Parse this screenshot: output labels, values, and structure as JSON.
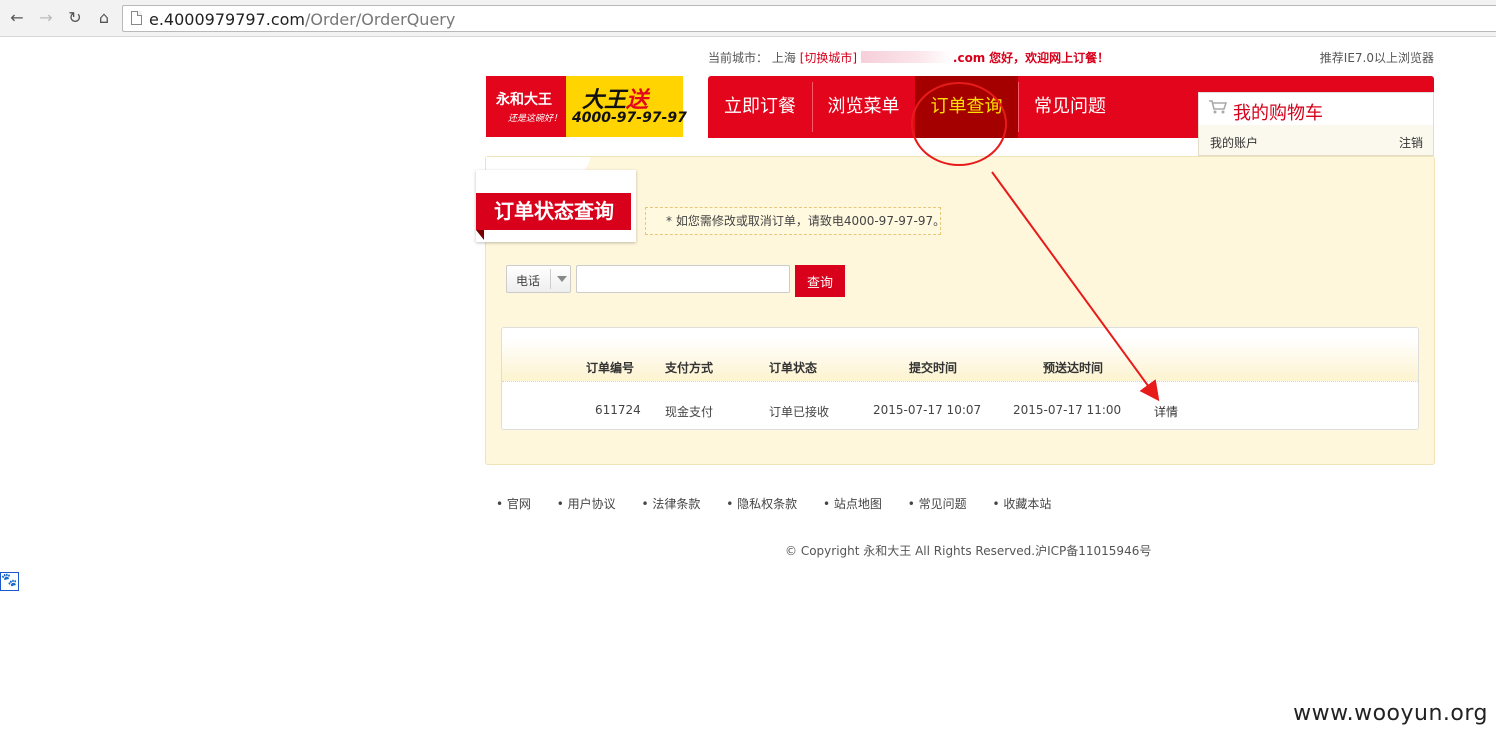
{
  "browser": {
    "back_icon": "←",
    "forward_icon": "→",
    "reload_icon": "↻",
    "home_icon": "⌂",
    "url_host": "e.4000979797.com",
    "url_path": "/Order/OrderQuery"
  },
  "topbar": {
    "city_label": "当前城市：",
    "city": "上海",
    "switch_city": "[切换城市]",
    "user_suffix": ".com",
    "welcome": "您好，欢迎网上订餐！",
    "browser_tip": "推荐IE7.0以上浏览器"
  },
  "logo": {
    "brand": "永和大王",
    "slogan": "还是这碗好！",
    "delivery": "大王",
    "delivery_red": "送",
    "phone": "4000-97-97-97"
  },
  "nav": {
    "items": [
      "立即订餐",
      "浏览菜单",
      "订单查询",
      "常见问题"
    ],
    "active_index": 2
  },
  "cart": {
    "icon": "cart-icon",
    "label": "我的购物车",
    "my_account": "我的账户",
    "logout": "注销"
  },
  "section": {
    "title": "订单状态查询",
    "notice": "* 如您需修改或取消订单，请致电4000-97-97-97。"
  },
  "search": {
    "type_selected": "电话",
    "input_value": "",
    "button_label": "查询"
  },
  "orders": {
    "headers": [
      "订单编号",
      "支付方式",
      "订单状态",
      "提交时间",
      "预送达时间"
    ],
    "rows": [
      {
        "order_no": "611724",
        "payment": "现金支付",
        "status": "订单已接收",
        "submitted": "2015-07-17 10:07",
        "eta": "2015-07-17 11:00",
        "action": "详情"
      }
    ]
  },
  "footer": {
    "links": [
      "官网",
      "用户协议",
      "法律条款",
      "隐私权条款",
      "站点地图",
      "常见问题",
      "收藏本站"
    ],
    "copyright": "© Copyright 永和大王 All Rights Reserved.沪ICP备11015946号"
  },
  "baidu_icon": "🐾",
  "watermark": "www.wooyun.org",
  "colors": {
    "brand_red": "#e3051b",
    "active_nav": "#a40000",
    "active_text": "#ffe100",
    "panel_bg": "#fef7dc",
    "annotation": "#e81b1b"
  }
}
